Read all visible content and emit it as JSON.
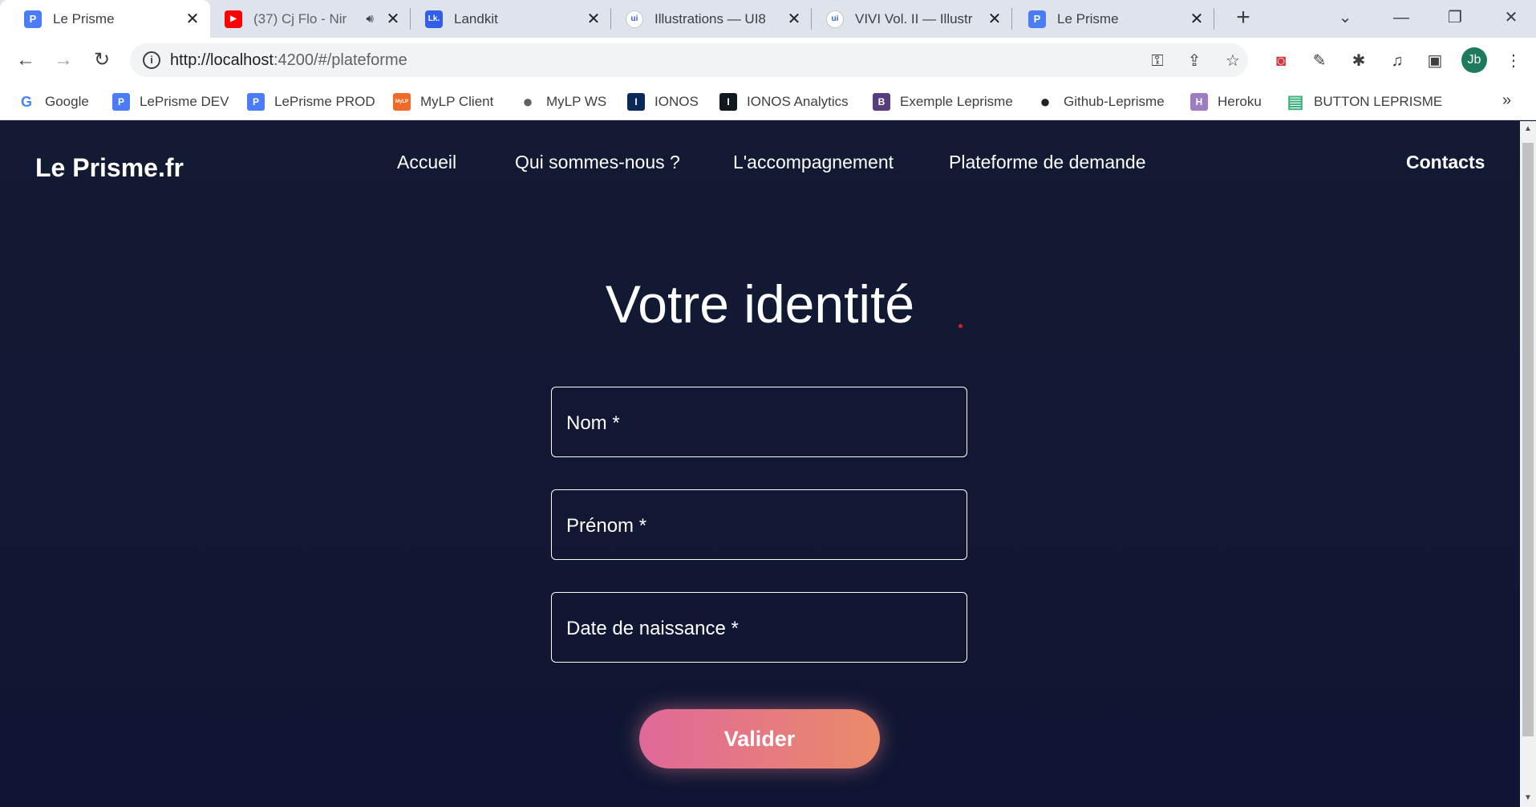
{
  "browser": {
    "tabs": [
      {
        "title": "Le Prisme",
        "icon": "P",
        "icon_color": "#4a7cf7"
      },
      {
        "title": "(37) Cj Flo - Nir",
        "icon": "▶",
        "icon_color": "#ff0000"
      },
      {
        "title": "Landkit",
        "icon": "Lk.",
        "icon_color": "#335eea"
      },
      {
        "title": "Illustrations — UI8",
        "icon": "ui",
        "icon_color": "#ffffff"
      },
      {
        "title": "VIVI Vol. II — Illustr",
        "icon": "ui",
        "icon_color": "#ffffff"
      },
      {
        "title": "Le Prisme",
        "icon": "P",
        "icon_color": "#4a7cf7"
      }
    ],
    "url_host": "http://localhost",
    "url_rest": ":4200/#/plateforme",
    "profile_initials": "Jb",
    "bookmarks": [
      {
        "label": "Google",
        "icon": "G",
        "icon_color": "#4285f4"
      },
      {
        "label": "LePrisme DEV",
        "icon": "P",
        "icon_color": "#4a7cf7"
      },
      {
        "label": "LePrisme PROD",
        "icon": "P",
        "icon_color": "#4a7cf7"
      },
      {
        "label": "MyLP Client",
        "icon": "MyLP",
        "icon_color": "#f06a2a"
      },
      {
        "label": "MyLP WS",
        "icon": "●",
        "icon_color": "#5f6368"
      },
      {
        "label": "IONOS",
        "icon": "I",
        "icon_color": "#0b2a5a"
      },
      {
        "label": "IONOS Analytics",
        "icon": "I",
        "icon_color": "#101820"
      },
      {
        "label": "Exemple Leprisme",
        "icon": "B",
        "icon_color": "#563d7c"
      },
      {
        "label": "Github-Leprisme",
        "icon": "●",
        "icon_color": "#202124"
      },
      {
        "label": "Heroku",
        "icon": "H",
        "icon_color": "#9e7cc1"
      },
      {
        "label": "BUTTON LEPRISME",
        "icon": "▤",
        "icon_color": "#3ab07a"
      }
    ]
  },
  "site": {
    "brand": "Le Prisme.fr",
    "nav": [
      "Accueil",
      "Qui sommes-nous ?",
      "L'accompagnement",
      "Plateforme de demande"
    ],
    "contacts": "Contacts"
  },
  "form": {
    "title": "Votre identité",
    "fields": [
      "Nom *",
      "Prénom *",
      "Date de naissance *"
    ],
    "submit": "Valider"
  }
}
